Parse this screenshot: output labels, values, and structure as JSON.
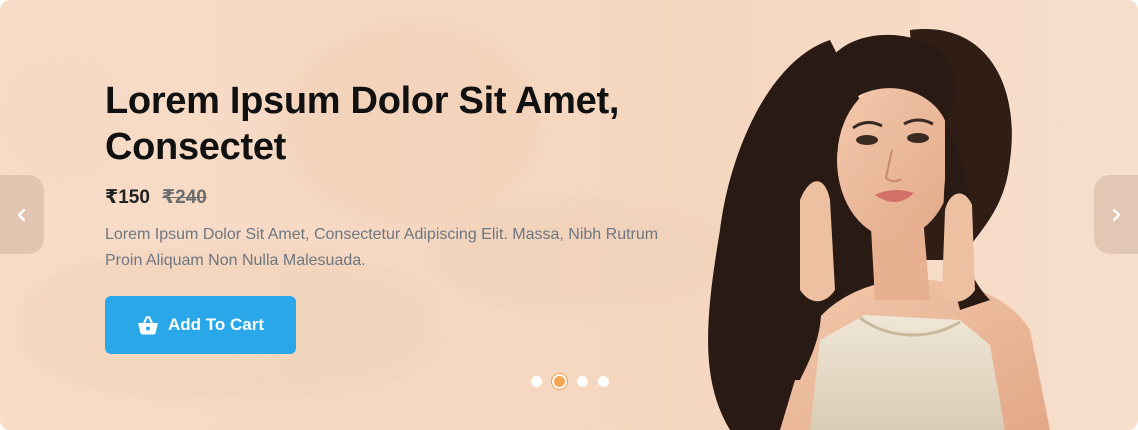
{
  "banner": {
    "title_line1": "Lorem Ipsum Dolor Sit Amet,",
    "title_line2": "Consectet",
    "price_current": "₹150",
    "price_original": "₹240",
    "description": "Lorem Ipsum Dolor Sit Amet, Consectetur Adipiscing Elit. Massa, Nibh Rutrum Proin Aliquam Non Nulla Malesuada.",
    "cart_button_label": "Add To Cart",
    "cart_button_icon": "basket-icon"
  },
  "navigation": {
    "prev_icon": "chevron-left-icon",
    "next_icon": "chevron-right-icon"
  },
  "pagination": {
    "total_slides": 4,
    "active_index": 1
  },
  "colors": {
    "background": "#f6d9c3",
    "button": "#29a7e8",
    "active_dot": "#f5a654",
    "title_text": "#111111",
    "description_text": "#6e7681"
  }
}
